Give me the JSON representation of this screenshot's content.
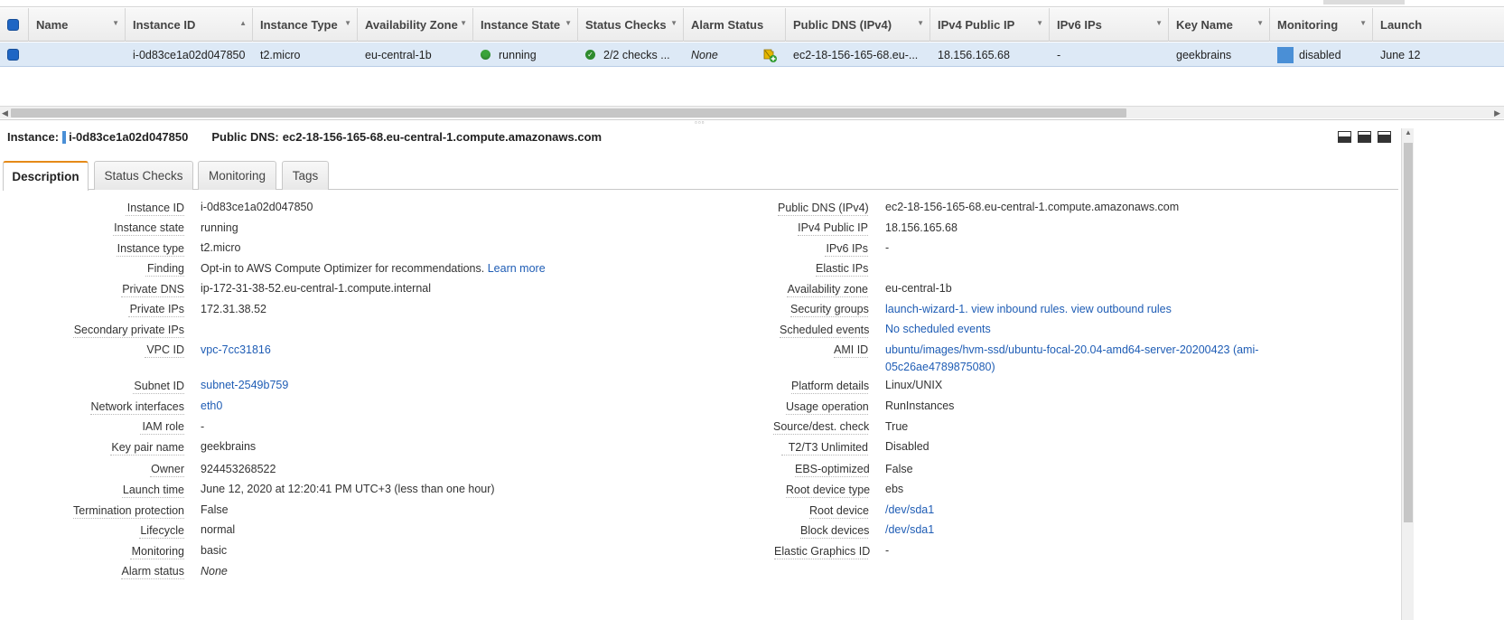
{
  "grid": {
    "columns": [
      {
        "label": "Name",
        "sort": "▼"
      },
      {
        "label": "Instance ID",
        "sort": "▲"
      },
      {
        "label": "Instance Type",
        "sort": "▼"
      },
      {
        "label": "Availability Zone",
        "sort": "▼"
      },
      {
        "label": "Instance State",
        "sort": "▼"
      },
      {
        "label": "Status Checks",
        "sort": "▼"
      },
      {
        "label": "Alarm Status",
        "sort": ""
      },
      {
        "label": "Public DNS (IPv4)",
        "sort": "▼"
      },
      {
        "label": "IPv4 Public IP",
        "sort": "▼"
      },
      {
        "label": "IPv6 IPs",
        "sort": "▼"
      },
      {
        "label": "Key Name",
        "sort": "▼"
      },
      {
        "label": "Monitoring",
        "sort": "▼"
      },
      {
        "label": "Launch",
        "sort": ""
      }
    ],
    "row": {
      "name": "",
      "instance_id": "i-0d83ce1a02d047850",
      "instance_type": "t2.micro",
      "availability_zone": "eu-central-1b",
      "instance_state": "running",
      "status_checks": "2/2 checks ...",
      "alarm_status": "None",
      "public_dns": "ec2-18-156-165-68.eu-...",
      "ipv4_public_ip": "18.156.165.68",
      "ipv6_ips": "-",
      "key_name": "geekbrains",
      "monitoring": "disabled",
      "launch": "June 12"
    },
    "scroll_left": "◀",
    "scroll_right": "▶"
  },
  "details": {
    "instance_label": "Instance:",
    "instance_id": "i-0d83ce1a02d047850",
    "public_dns_label": "Public DNS:",
    "public_dns": "ec2-18-156-165-68.eu-central-1.compute.amazonaws.com",
    "tabs": [
      "Description",
      "Status Checks",
      "Monitoring",
      "Tags"
    ],
    "active_tab": "Description",
    "left": [
      {
        "label": "Instance ID",
        "value": "i-0d83ce1a02d047850"
      },
      {
        "label": "Instance state",
        "value": "running"
      },
      {
        "label": "Instance type",
        "value": "t2.micro"
      },
      {
        "label": "Finding",
        "value": "Opt-in to AWS Compute Optimizer for recommendations.",
        "link": "Learn more"
      },
      {
        "label": "Private DNS",
        "value": "ip-172-31-38-52.eu-central-1.compute.internal"
      },
      {
        "label": "Private IPs",
        "value": "172.31.38.52"
      },
      {
        "label": "Secondary private IPs",
        "value": ""
      },
      {
        "label": "VPC ID",
        "value": "vpc-7cc31816"
      },
      {
        "label": "Subnet ID",
        "value": "subnet-2549b759"
      },
      {
        "label": "Network interfaces",
        "value": "eth0"
      },
      {
        "label": "IAM role",
        "value": "-"
      },
      {
        "label": "Key pair name",
        "value": "geekbrains"
      },
      {
        "label": "Owner",
        "value": "924453268522"
      },
      {
        "label": "Launch time",
        "value": "June 12, 2020 at 12:20:41 PM UTC+3 (less than one hour)"
      },
      {
        "label": "Termination protection",
        "value": "False"
      },
      {
        "label": "Lifecycle",
        "value": "normal"
      },
      {
        "label": "Monitoring",
        "value": "basic"
      },
      {
        "label": "Alarm status",
        "value": "None"
      }
    ],
    "right": [
      {
        "label": "Public DNS (IPv4)",
        "value": "ec2-18-156-165-68.eu-central-1.compute.amazonaws.com"
      },
      {
        "label": "IPv4 Public IP",
        "value": "18.156.165.68"
      },
      {
        "label": "IPv6 IPs",
        "value": "-"
      },
      {
        "label": "Elastic IPs",
        "value": ""
      },
      {
        "label": "Availability zone",
        "value": "eu-central-1b"
      },
      {
        "label": "Security groups",
        "value": "launch-wizard-1.",
        "link1": "view inbound rules.",
        "link2": "view outbound rules"
      },
      {
        "label": "Scheduled events",
        "value": "No scheduled events"
      },
      {
        "label": "AMI ID",
        "value": "ubuntu/images/hvm-ssd/ubuntu-focal-20.04-amd64-server-20200423 (ami-05c26ae4789875080)"
      },
      {
        "label": "Platform details",
        "value": "Linux/UNIX"
      },
      {
        "label": "Usage operation",
        "value": "RunInstances"
      },
      {
        "label": "Source/dest. check",
        "value": "True"
      },
      {
        "label": "T2/T3 Unlimited",
        "value": "Disabled"
      },
      {
        "label": "EBS-optimized",
        "value": "False"
      },
      {
        "label": "Root device type",
        "value": "ebs"
      },
      {
        "label": "Root device",
        "value": "/dev/sda1"
      },
      {
        "label": "Block devices",
        "value": "/dev/sda1"
      },
      {
        "label": "Elastic Graphics ID",
        "value": "-"
      }
    ]
  },
  "colors": {
    "selected_row": "#dde9f6",
    "link": "#1f5db5",
    "running": "#3aa33a",
    "active_tab_accent": "#e58a18",
    "monitoring_box": "#4a8fd6"
  },
  "icons": [
    "checkbox-icon",
    "running-status-icon",
    "check-ok-icon",
    "alarm-add-icon",
    "monitoring-icon",
    "pane-layout-icon"
  ]
}
